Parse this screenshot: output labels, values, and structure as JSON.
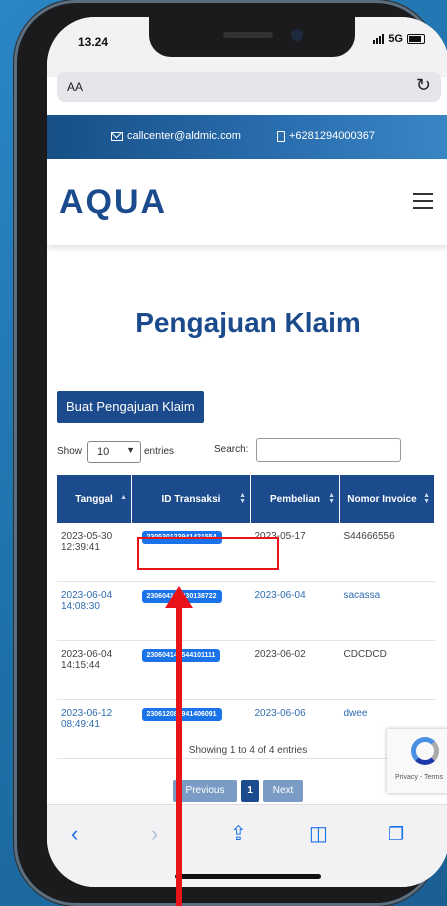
{
  "status": {
    "time": "13.24",
    "network": "5G"
  },
  "browser": {
    "address_text": "AA",
    "reload_icon": "reload-icon"
  },
  "topbar": {
    "email": "callcenter@aldmic.com",
    "phone": "+6281294000367"
  },
  "brand": {
    "logo": "AQUA"
  },
  "page": {
    "title": "Pengajuan Klaim",
    "new_button": "Buat Pengajuan Klaim",
    "show_label": "Show",
    "entries_value": "10",
    "entries_label": "entries",
    "search_label": "Search:",
    "search_value": ""
  },
  "table": {
    "headers": [
      "Tanggal",
      "ID Transaksi",
      "Pembelian",
      "Nomor Invoice"
    ],
    "rows": [
      {
        "date": "2023-05-30",
        "time": "12:39:41",
        "id": "230530123941421554",
        "purchase": "2023-05-17",
        "invoice": "S44666556"
      },
      {
        "date": "2023-06-04",
        "time": "14:08:30",
        "id": "230604140830138722",
        "purchase": "2023-06-04",
        "invoice": "sacassa"
      },
      {
        "date": "2023-06-04",
        "time": "14:15:44",
        "id": "230604141544101111",
        "purchase": "2023-06-02",
        "invoice": "CDCDCD"
      },
      {
        "date": "2023-06-12",
        "time": "08:49:41",
        "id": "230612084941406091",
        "purchase": "2023-06-06",
        "invoice": "dwee"
      }
    ]
  },
  "table_info": "Showing 1 to 4 of 4 entries",
  "pagination": {
    "previous": "Previous",
    "current": "1",
    "next": "Next"
  },
  "recaptcha": {
    "text": "Privacy - Terms"
  },
  "colors": {
    "brand": "#1b4b8c",
    "badge": "#1a73e8",
    "annotation": "#e8141a"
  }
}
